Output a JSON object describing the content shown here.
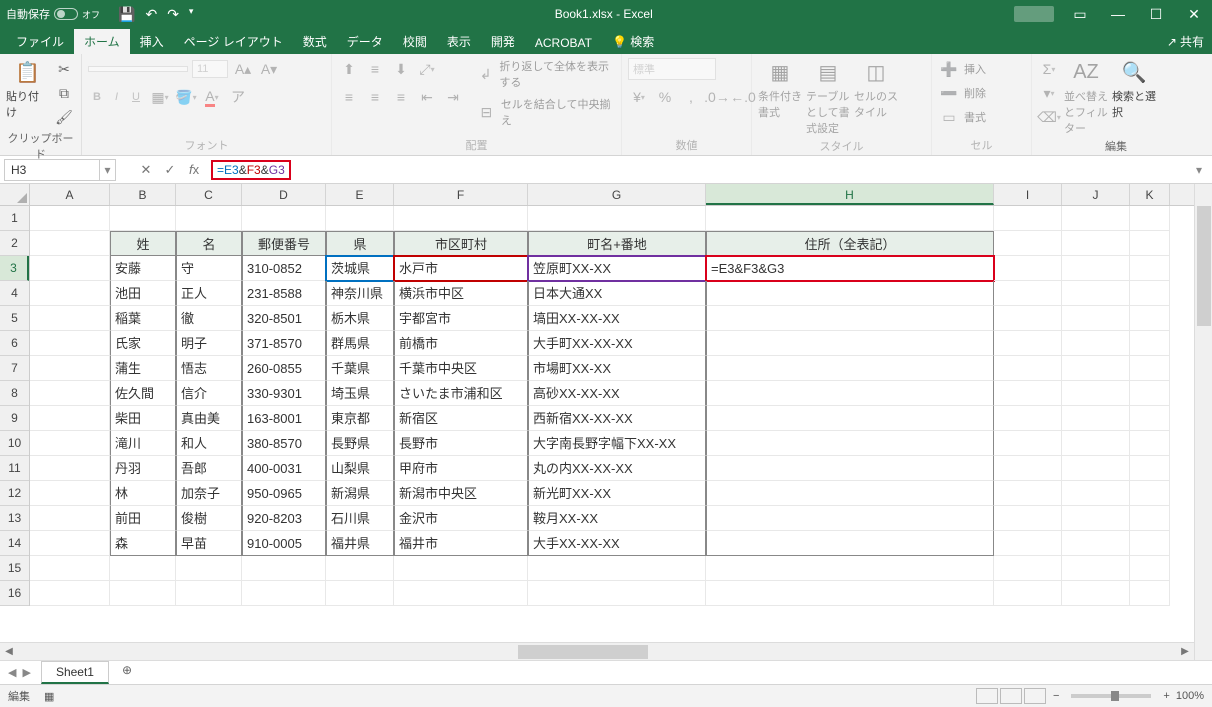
{
  "title": {
    "autosave": "自動保存",
    "off": "オフ",
    "filename": "Book1.xlsx  -  Excel"
  },
  "tabs": {
    "file": "ファイル",
    "home": "ホーム",
    "insert": "挿入",
    "layout": "ページ レイアウト",
    "formulas": "数式",
    "data": "データ",
    "review": "校閲",
    "view": "表示",
    "dev": "開発",
    "acrobat": "ACROBAT",
    "search": "検索",
    "share": "共有"
  },
  "ribbon": {
    "clipboard": {
      "paste": "貼り付け",
      "label": "クリップボード"
    },
    "font": {
      "label": "フォント",
      "size": "11",
      "b": "B",
      "i": "I",
      "u": "U"
    },
    "alignment": {
      "label": "配置",
      "wrap": "折り返して全体を表示する",
      "merge": "セルを結合して中央揃え"
    },
    "number": {
      "label": "数値",
      "format": "標準"
    },
    "styles": {
      "label": "スタイル",
      "cond": "条件付き書式",
      "table": "テーブルとして書式設定",
      "cell": "セルのスタイル"
    },
    "cells": {
      "label": "セル",
      "insert": "挿入",
      "delete": "削除",
      "format": "書式"
    },
    "editing": {
      "label": "編集",
      "sort": "並べ替えとフィルター",
      "find": "検索と選択"
    }
  },
  "formula_bar": {
    "name_box": "H3",
    "formula": "=E3&F3&G3",
    "e": "=E3",
    "amp1": "&",
    "f": "F3",
    "amp2": "&",
    "g": "G3"
  },
  "columns": [
    "A",
    "B",
    "C",
    "D",
    "E",
    "F",
    "G",
    "H",
    "I",
    "J",
    "K"
  ],
  "headers": {
    "B": "姓",
    "C": "名",
    "D": "郵便番号",
    "E": "県",
    "F": "市区町村",
    "G": "町名+番地",
    "H": "住所（全表記）"
  },
  "rows": [
    {
      "b": "安藤",
      "c": "守",
      "d": "310-0852",
      "e": "茨城県",
      "f": "水戸市",
      "g": "笠原町XX-XX",
      "h": "=E3&F3&G3"
    },
    {
      "b": "池田",
      "c": "正人",
      "d": "231-8588",
      "e": "神奈川県",
      "f": "横浜市中区",
      "g": "日本大通XX",
      "h": ""
    },
    {
      "b": "稲葉",
      "c": "徹",
      "d": "320-8501",
      "e": "栃木県",
      "f": "宇都宮市",
      "g": "塙田XX-XX-XX",
      "h": ""
    },
    {
      "b": "氏家",
      "c": "明子",
      "d": "371-8570",
      "e": "群馬県",
      "f": "前橋市",
      "g": "大手町XX-XX-XX",
      "h": ""
    },
    {
      "b": "蒲生",
      "c": "悟志",
      "d": "260-0855",
      "e": "千葉県",
      "f": "千葉市中央区",
      "g": "市場町XX-XX",
      "h": ""
    },
    {
      "b": "佐久間",
      "c": "信介",
      "d": "330-9301",
      "e": "埼玉県",
      "f": "さいたま市浦和区",
      "g": "高砂XX-XX-XX",
      "h": ""
    },
    {
      "b": "柴田",
      "c": "真由美",
      "d": "163-8001",
      "e": "東京都",
      "f": "新宿区",
      "g": "西新宿XX-XX-XX",
      "h": ""
    },
    {
      "b": "滝川",
      "c": "和人",
      "d": "380-8570",
      "e": "長野県",
      "f": "長野市",
      "g": "大字南長野字幅下XX-XX",
      "h": ""
    },
    {
      "b": "丹羽",
      "c": "吾郎",
      "d": "400-0031",
      "e": "山梨県",
      "f": "甲府市",
      "g": "丸の内XX-XX-XX",
      "h": ""
    },
    {
      "b": "林",
      "c": "加奈子",
      "d": "950-0965",
      "e": "新潟県",
      "f": "新潟市中央区",
      "g": "新光町XX-XX",
      "h": ""
    },
    {
      "b": "前田",
      "c": "俊樹",
      "d": "920-8203",
      "e": "石川県",
      "f": "金沢市",
      "g": "鞍月XX-XX",
      "h": ""
    },
    {
      "b": "森",
      "c": "早苗",
      "d": "910-0005",
      "e": "福井県",
      "f": "福井市",
      "g": "大手XX-XX-XX",
      "h": ""
    }
  ],
  "sheet": {
    "name": "Sheet1"
  },
  "status": {
    "mode": "編集",
    "zoom": "100%"
  }
}
